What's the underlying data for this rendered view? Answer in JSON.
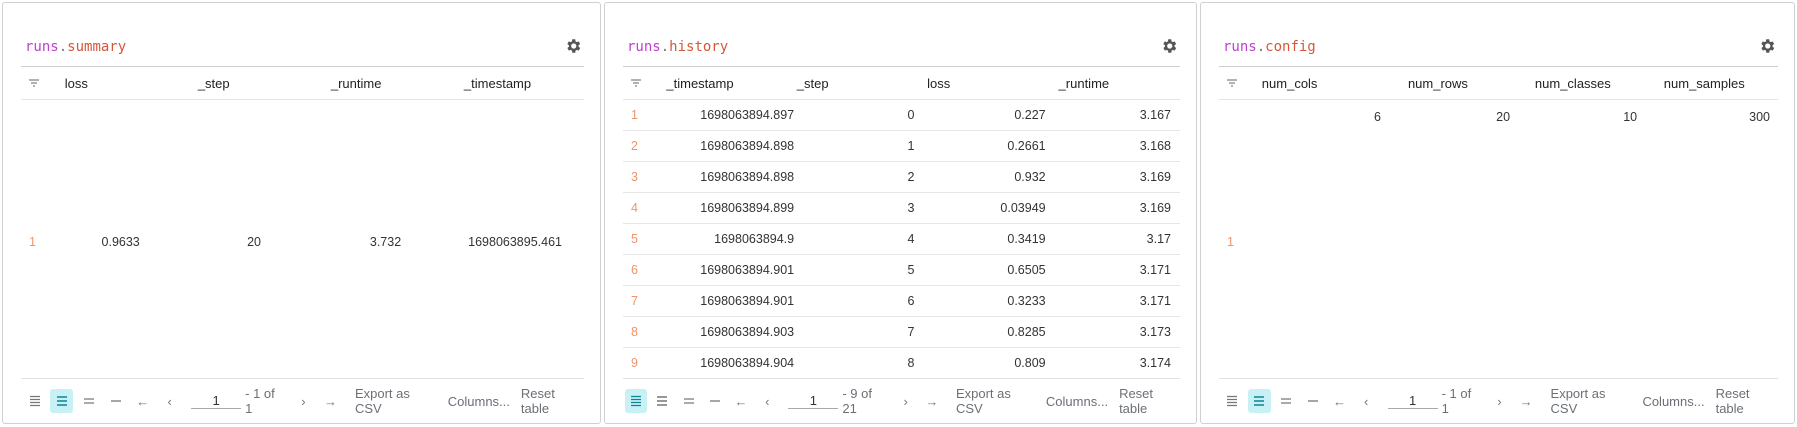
{
  "footer": {
    "export": "Export as CSV",
    "columns": "Columns...",
    "reset": "Reset table"
  },
  "panels": [
    {
      "prefix": "runs",
      "key": "summary",
      "page": "1",
      "range": "- 1 of 1",
      "active_density": 1,
      "columns": [
        "loss",
        "_step",
        "_runtime",
        "_timestamp"
      ],
      "rows": [
        {
          "index": "1",
          "cells": [
            "0.9633",
            "20",
            "3.732",
            "1698063895.461"
          ]
        }
      ]
    },
    {
      "prefix": "runs",
      "key": "history",
      "page": "1",
      "range": "- 9 of 21",
      "active_density": 0,
      "columns": [
        "_timestamp",
        "_step",
        "loss",
        "_runtime"
      ],
      "rows": [
        {
          "index": "1",
          "cells": [
            "1698063894.897",
            "0",
            "0.227",
            "3.167"
          ]
        },
        {
          "index": "2",
          "cells": [
            "1698063894.898",
            "1",
            "0.2661",
            "3.168"
          ]
        },
        {
          "index": "3",
          "cells": [
            "1698063894.898",
            "2",
            "0.932",
            "3.169"
          ]
        },
        {
          "index": "4",
          "cells": [
            "1698063894.899",
            "3",
            "0.03949",
            "3.169"
          ]
        },
        {
          "index": "5",
          "cells": [
            "1698063894.9",
            "4",
            "0.3419",
            "3.17"
          ]
        },
        {
          "index": "6",
          "cells": [
            "1698063894.901",
            "5",
            "0.6505",
            "3.171"
          ]
        },
        {
          "index": "7",
          "cells": [
            "1698063894.901",
            "6",
            "0.3233",
            "3.171"
          ]
        },
        {
          "index": "8",
          "cells": [
            "1698063894.903",
            "7",
            "0.8285",
            "3.173"
          ]
        },
        {
          "index": "9",
          "cells": [
            "1698063894.904",
            "8",
            "0.809",
            "3.174"
          ]
        }
      ]
    },
    {
      "prefix": "runs",
      "key": "config",
      "page": "1",
      "range": "- 1 of 1",
      "active_density": 1,
      "columns": [
        "num_cols",
        "num_rows",
        "num_classes",
        "num_samples"
      ],
      "rows": [
        {
          "index": "1",
          "cells": [
            "6",
            "20",
            "10",
            "300"
          ]
        }
      ]
    }
  ],
  "colors": {
    "prefix": "#c040d0",
    "key": "#d5583a",
    "index": "#f0946a",
    "active_bg": "#c8f1f5",
    "active_icon": "#0a8496"
  }
}
